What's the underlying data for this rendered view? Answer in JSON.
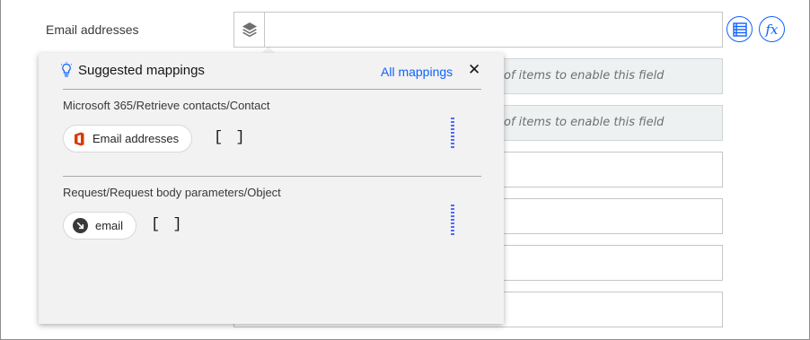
{
  "field": {
    "label": "Email addresses",
    "value": "",
    "layers_icon": "layers-icon",
    "list_icon": "list-icon",
    "fx_label": "fx"
  },
  "background_rows": {
    "disabled_text_1": "of items to enable this field",
    "disabled_text_2": "of items to enable this field"
  },
  "popover": {
    "title": "Suggested mappings",
    "title_icon": "lightbulb-icon",
    "all_mappings_label": "All mappings",
    "close_icon": "close-icon",
    "groups": [
      {
        "path": "Microsoft 365/Retrieve contacts/Contact",
        "chip_label": "Email addresses",
        "chip_icon": "office-icon",
        "type": "[ ]"
      },
      {
        "path": "Request/Request body parameters/Object",
        "chip_label": "email",
        "chip_icon": "arrow-icon",
        "type": "[ ]"
      }
    ]
  },
  "colors": {
    "accent": "#0f62fe",
    "office": "#d83b01",
    "popover_bg": "#f2f2f2",
    "disabled_bg": "#eef1f2"
  }
}
